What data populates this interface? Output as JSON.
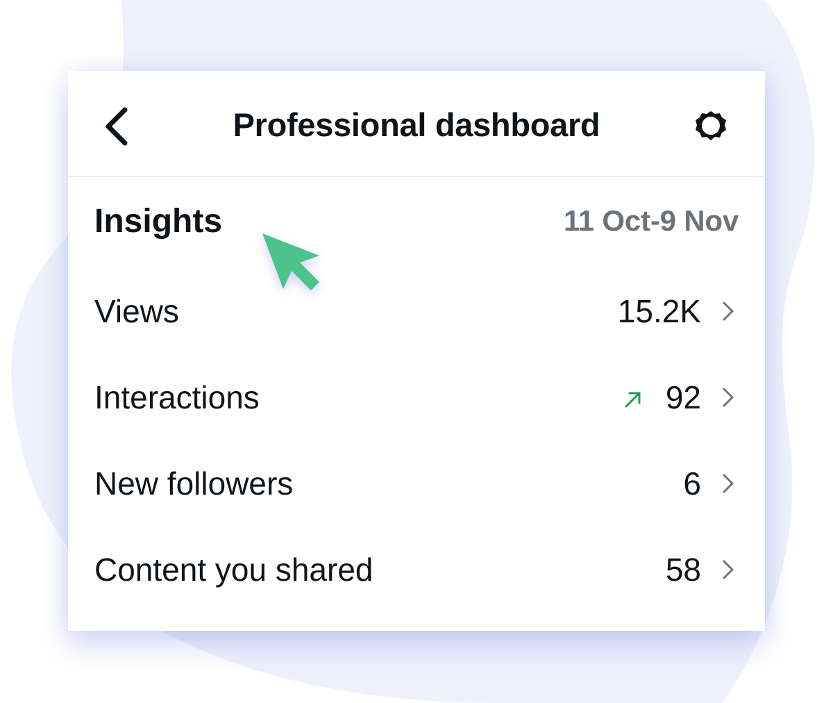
{
  "header": {
    "title": "Professional dashboard",
    "back_icon": "chevron-left-icon",
    "settings_icon": "gear-icon"
  },
  "insights": {
    "title": "Insights",
    "date_range": "11 Oct-9 Nov"
  },
  "metrics": [
    {
      "label": "Views",
      "value": "15.2K"
    },
    {
      "label": "Interactions",
      "value": "92",
      "trend": "up"
    },
    {
      "label": "New followers",
      "value": "6"
    },
    {
      "label": "Content you shared",
      "value": "58"
    }
  ],
  "colors": {
    "text_primary": "#0f1419",
    "text_secondary": "#6c727a",
    "trend_up": "#1f9d55",
    "cursor": "#4cc38a",
    "backdrop_blob": "#eef1fb",
    "chevron": "#6c727a"
  }
}
